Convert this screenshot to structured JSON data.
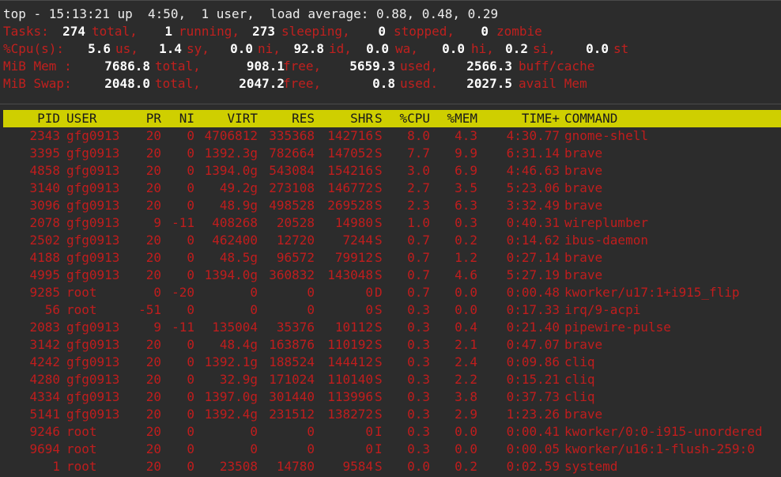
{
  "summary": {
    "top_line": "top - 15:13:21 up  4:50,  1 user,  load average: 0.88, 0.48, 0.29",
    "tasks": {
      "label": "Tasks:",
      "total": "274",
      "total_lbl": "total,",
      "running": "1",
      "running_lbl": "running,",
      "sleeping": "273",
      "sleeping_lbl": "sleeping,",
      "stopped": "0",
      "stopped_lbl": "stopped,",
      "zombie": "0",
      "zombie_lbl": "zombie"
    },
    "cpu": {
      "label": "%Cpu(s):",
      "us": "5.6",
      "us_lbl": "us,",
      "sy": "1.4",
      "sy_lbl": "sy,",
      "ni": "0.0",
      "ni_lbl": "ni,",
      "id": "92.8",
      "id_lbl": "id,",
      "wa": "0.0",
      "wa_lbl": "wa,",
      "hi": "0.0",
      "hi_lbl": "hi,",
      "si": "0.2",
      "si_lbl": "si,",
      "st": "0.0",
      "st_lbl": "st"
    },
    "mem": {
      "label": "MiB Mem :",
      "total": "7686.8",
      "total_lbl": "total,",
      "free": "908.1",
      "free_lbl": "free,",
      "used": "5659.3",
      "used_lbl": "used,",
      "buff": "2566.3",
      "buff_lbl": "buff/cache"
    },
    "swap": {
      "label": "MiB Swap:",
      "total": "2048.0",
      "total_lbl": "total,",
      "free": "2047.2",
      "free_lbl": "free,",
      "used": "0.8",
      "used_lbl": "used.",
      "avail": "2027.5",
      "avail_lbl": "avail Mem"
    }
  },
  "columns": [
    "PID",
    "USER",
    "PR",
    "NI",
    "VIRT",
    "RES",
    "SHR",
    "S",
    "%CPU",
    "%MEM",
    "TIME+",
    "COMMAND"
  ],
  "processes": [
    [
      "2343",
      "gfg0913",
      "20",
      "0",
      "4706812",
      "335368",
      "142716",
      "S",
      "8.0",
      "4.3",
      "4:30.77",
      "gnome-shell"
    ],
    [
      "3395",
      "gfg0913",
      "20",
      "0",
      "1392.3g",
      "782664",
      "147052",
      "S",
      "7.7",
      "9.9",
      "6:31.14",
      "brave"
    ],
    [
      "4858",
      "gfg0913",
      "20",
      "0",
      "1394.0g",
      "543084",
      "154216",
      "S",
      "3.0",
      "6.9",
      "4:46.63",
      "brave"
    ],
    [
      "3140",
      "gfg0913",
      "20",
      "0",
      "49.2g",
      "273108",
      "146772",
      "S",
      "2.7",
      "3.5",
      "5:23.06",
      "brave"
    ],
    [
      "3096",
      "gfg0913",
      "20",
      "0",
      "48.9g",
      "498528",
      "269528",
      "S",
      "2.3",
      "6.3",
      "3:32.49",
      "brave"
    ],
    [
      "2078",
      "gfg0913",
      "9",
      "-11",
      "408268",
      "20528",
      "14980",
      "S",
      "1.0",
      "0.3",
      "0:40.31",
      "wireplumber"
    ],
    [
      "2502",
      "gfg0913",
      "20",
      "0",
      "462400",
      "12720",
      "7244",
      "S",
      "0.7",
      "0.2",
      "0:14.62",
      "ibus-daemon"
    ],
    [
      "4188",
      "gfg0913",
      "20",
      "0",
      "48.5g",
      "96572",
      "79912",
      "S",
      "0.7",
      "1.2",
      "0:27.14",
      "brave"
    ],
    [
      "4995",
      "gfg0913",
      "20",
      "0",
      "1394.0g",
      "360832",
      "143048",
      "S",
      "0.7",
      "4.6",
      "5:27.19",
      "brave"
    ],
    [
      "9285",
      "root",
      "0",
      "-20",
      "0",
      "0",
      "0",
      "D",
      "0.7",
      "0.0",
      "0:00.48",
      "kworker/u17:1+i915_flip"
    ],
    [
      "56",
      "root",
      "-51",
      "0",
      "0",
      "0",
      "0",
      "S",
      "0.3",
      "0.0",
      "0:17.33",
      "irq/9-acpi"
    ],
    [
      "2083",
      "gfg0913",
      "9",
      "-11",
      "135004",
      "35376",
      "10112",
      "S",
      "0.3",
      "0.4",
      "0:21.40",
      "pipewire-pulse"
    ],
    [
      "3142",
      "gfg0913",
      "20",
      "0",
      "48.4g",
      "163876",
      "110192",
      "S",
      "0.3",
      "2.1",
      "0:47.07",
      "brave"
    ],
    [
      "4242",
      "gfg0913",
      "20",
      "0",
      "1392.1g",
      "188524",
      "144412",
      "S",
      "0.3",
      "2.4",
      "0:09.86",
      "cliq"
    ],
    [
      "4280",
      "gfg0913",
      "20",
      "0",
      "32.9g",
      "171024",
      "110140",
      "S",
      "0.3",
      "2.2",
      "0:15.21",
      "cliq"
    ],
    [
      "4334",
      "gfg0913",
      "20",
      "0",
      "1397.0g",
      "301440",
      "113996",
      "S",
      "0.3",
      "3.8",
      "0:37.73",
      "cliq"
    ],
    [
      "5141",
      "gfg0913",
      "20",
      "0",
      "1392.4g",
      "231512",
      "138272",
      "S",
      "0.3",
      "2.9",
      "1:23.26",
      "brave"
    ],
    [
      "9246",
      "root",
      "20",
      "0",
      "0",
      "0",
      "0",
      "I",
      "0.3",
      "0.0",
      "0:00.41",
      "kworker/0:0-i915-unordered"
    ],
    [
      "9694",
      "root",
      "20",
      "0",
      "0",
      "0",
      "0",
      "I",
      "0.3",
      "0.0",
      "0:00.05",
      "kworker/u16:1-flush-259:0"
    ],
    [
      "1",
      "root",
      "20",
      "0",
      "23508",
      "14780",
      "9584",
      "S",
      "0.0",
      "0.2",
      "0:02.59",
      "systemd"
    ]
  ]
}
